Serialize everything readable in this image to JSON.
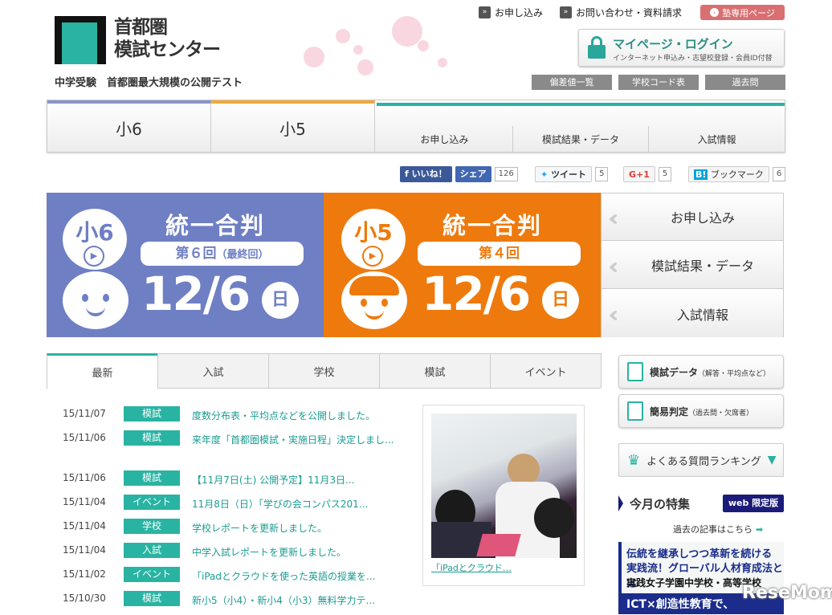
{
  "header": {
    "logo_line1": "首都圏",
    "logo_line2": "模試センター",
    "tagline": "中学受験　首都圏最大規模の公開テスト",
    "top_links": [
      "お申し込み",
      "お問い合わせ・資料請求"
    ],
    "juku_button": "塾専用ページ",
    "mypage_title": "マイページ・ログイン",
    "mypage_sub": "インターネット申込み・志望校登録・会員ID付替",
    "gray_buttons": [
      "偏差値一覧",
      "学校コード表",
      "過去問"
    ]
  },
  "nav": {
    "grades": [
      "小6",
      "小5"
    ],
    "sub_items": [
      "お申し込み",
      "模試結果・データ",
      "入試情報"
    ],
    "colors": {
      "grade6": "#8a93c9",
      "grade5": "#f0a93a",
      "accent": "#29b3a2"
    }
  },
  "social": {
    "fb_like": "いいね！",
    "fb_share": "シェア",
    "fb_count": "126",
    "tweet": "ツイート",
    "tweet_count": "5",
    "gplus": "G+1",
    "gplus_count": "5",
    "hatena": "ブックマーク",
    "hatena_count": "6"
  },
  "banners": [
    {
      "grade": "小6",
      "title": "統一合判",
      "round": "第６回",
      "round_note": "（最終回）",
      "date": "12/6",
      "day": "日",
      "color": "#6f7fc4"
    },
    {
      "grade": "小5",
      "title": "統一合判",
      "round": "第４回",
      "round_note": "",
      "date": "12/6",
      "day": "日",
      "color": "#ee7a0d"
    }
  ],
  "side_links": [
    "お申し込み",
    "模試結果・データ",
    "入試情報"
  ],
  "tabs": [
    "最新",
    "入試",
    "学校",
    "模試",
    "イベント"
  ],
  "news": [
    {
      "date": "15/11/07",
      "cat": "模試",
      "text": "度数分布表・平均点などを公開しました。"
    },
    {
      "date": "15/11/06",
      "cat": "模試",
      "text": "来年度「首都圏模試・実施日程」決定しまし..."
    },
    {
      "date": "15/11/06",
      "cat": "模試",
      "text": "【11月7日(土) 公開予定】11月3日..."
    },
    {
      "date": "15/11/04",
      "cat": "イベント",
      "text": "11月8日（日）「学びの会コンパス201..."
    },
    {
      "date": "15/11/04",
      "cat": "学校",
      "text": "学校レポートを更新しました。"
    },
    {
      "date": "15/11/04",
      "cat": "入試",
      "text": "中学入試レポートを更新しました。"
    },
    {
      "date": "15/11/02",
      "cat": "イベント",
      "text": "「iPadとクラウドを使った英語の授業を..."
    },
    {
      "date": "15/10/30",
      "cat": "模試",
      "text": "新小5（小4）・新小4（小3）無料学力テ..."
    }
  ],
  "photo_caption": "「iPadとクラウド…",
  "right": {
    "mogi_data": "模試データ",
    "mogi_data_note": "（解答・平均点など）",
    "kan_i": "簡易判定",
    "kan_i_note": "（過去問・欠席者）",
    "faq": "よくある質問ランキング",
    "feature_title": "今月の特集",
    "web_badge": "web 限定版",
    "past_articles": "過去の記事はこちら",
    "feature_line1": "伝統を継承しつつ革新を続ける",
    "feature_line2": "実践流！グローバル人材育成法とは",
    "feature_line3": "実践女子学園中学校・高等学校",
    "feature_line4": "ICT×創造性教育で、"
  },
  "watermark": "ReseMom"
}
